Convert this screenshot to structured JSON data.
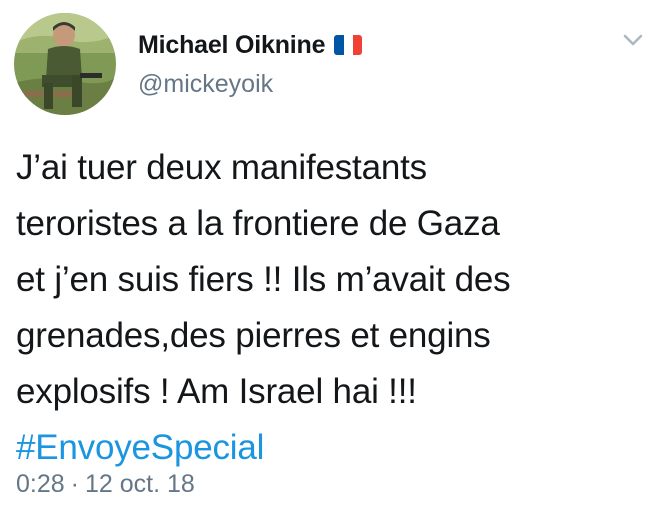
{
  "tweet": {
    "author": {
      "display_name": "Michael Oiknine",
      "handle": "@mickeyoik",
      "flag_icon": "france-flag-icon",
      "flag_colors": [
        "#0055a4",
        "#ffffff",
        "#ef4135"
      ]
    },
    "text_lines": [
      "J’ai tuer deux manifestants",
      "teroristes a la frontiere de Gaza",
      "et j’en suis fiers !! Ils m’avait des",
      "grenades,des pierres et engins",
      "explosifs ! Am Israel hai !!!"
    ],
    "hashtag": "#EnvoyeSpecial",
    "time": "0:28",
    "separator": "·",
    "date": "12 oct. 18",
    "menu_icon": "chevron-down-icon",
    "colors": {
      "text": "#14171a",
      "secondary": "#657786",
      "link": "#1b95e0"
    }
  }
}
